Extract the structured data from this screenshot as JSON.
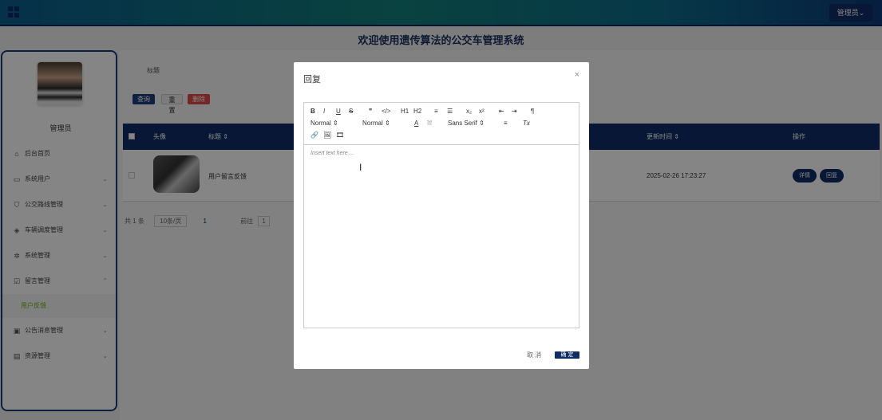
{
  "topbar": {
    "admin_label": "管理员⌄"
  },
  "page_title": "欢迎使用遗传算法的公交车管理系统",
  "sidebar": {
    "admin_name": "管理员",
    "items": [
      {
        "label": "后台首页",
        "icon": "home-icon"
      },
      {
        "label": "系统用户",
        "icon": "monitor-icon"
      },
      {
        "label": "公交路线管理",
        "icon": "bookmark-icon"
      },
      {
        "label": "车辆调度管理",
        "icon": "tag-icon"
      },
      {
        "label": "系统管理",
        "icon": "gear-icon"
      },
      {
        "label": "留言管理",
        "icon": "message-icon"
      },
      {
        "label": "公告消息管理",
        "icon": "clipboard-icon"
      },
      {
        "label": "资源管理",
        "icon": "chat-icon"
      }
    ],
    "sub_active": "用户反馈"
  },
  "search": {
    "label": "标题"
  },
  "buttons": {
    "query": "查询",
    "reset": "重置",
    "delete": "删除"
  },
  "table": {
    "headers": {
      "avatar": "头像",
      "title": "标题 ⇕",
      "updated": "更新时间 ⇕",
      "actions": "操作"
    },
    "rows": [
      {
        "title": "用户留言反馈",
        "updated": "2025-02-26 17:23:27",
        "detail": "详情",
        "reply": "回复"
      }
    ]
  },
  "pager": {
    "total": "共 1 条",
    "page_size": "10条/页",
    "current_page": "1",
    "goto": "前往",
    "goto_value": "1"
  },
  "dialog": {
    "title": "回复",
    "close": "×",
    "toolbar_row1": [
      "B",
      "I",
      "U",
      "S",
      "❞",
      "</>",
      "H1",
      "H2",
      "≡",
      "☰",
      "x₂",
      "x²",
      "⇤",
      "⇥",
      "¶"
    ],
    "toolbar_row2": [
      "Normal ⇕",
      "Normal ⇕",
      "A",
      "⛆",
      "Sans Serif ⇕",
      "≡",
      "Tx"
    ],
    "toolbar_row3": [
      "🔗",
      "🖼",
      "🎞"
    ],
    "placeholder": "Insert text here ...",
    "cancel": "取 消",
    "ok": "确 定"
  }
}
